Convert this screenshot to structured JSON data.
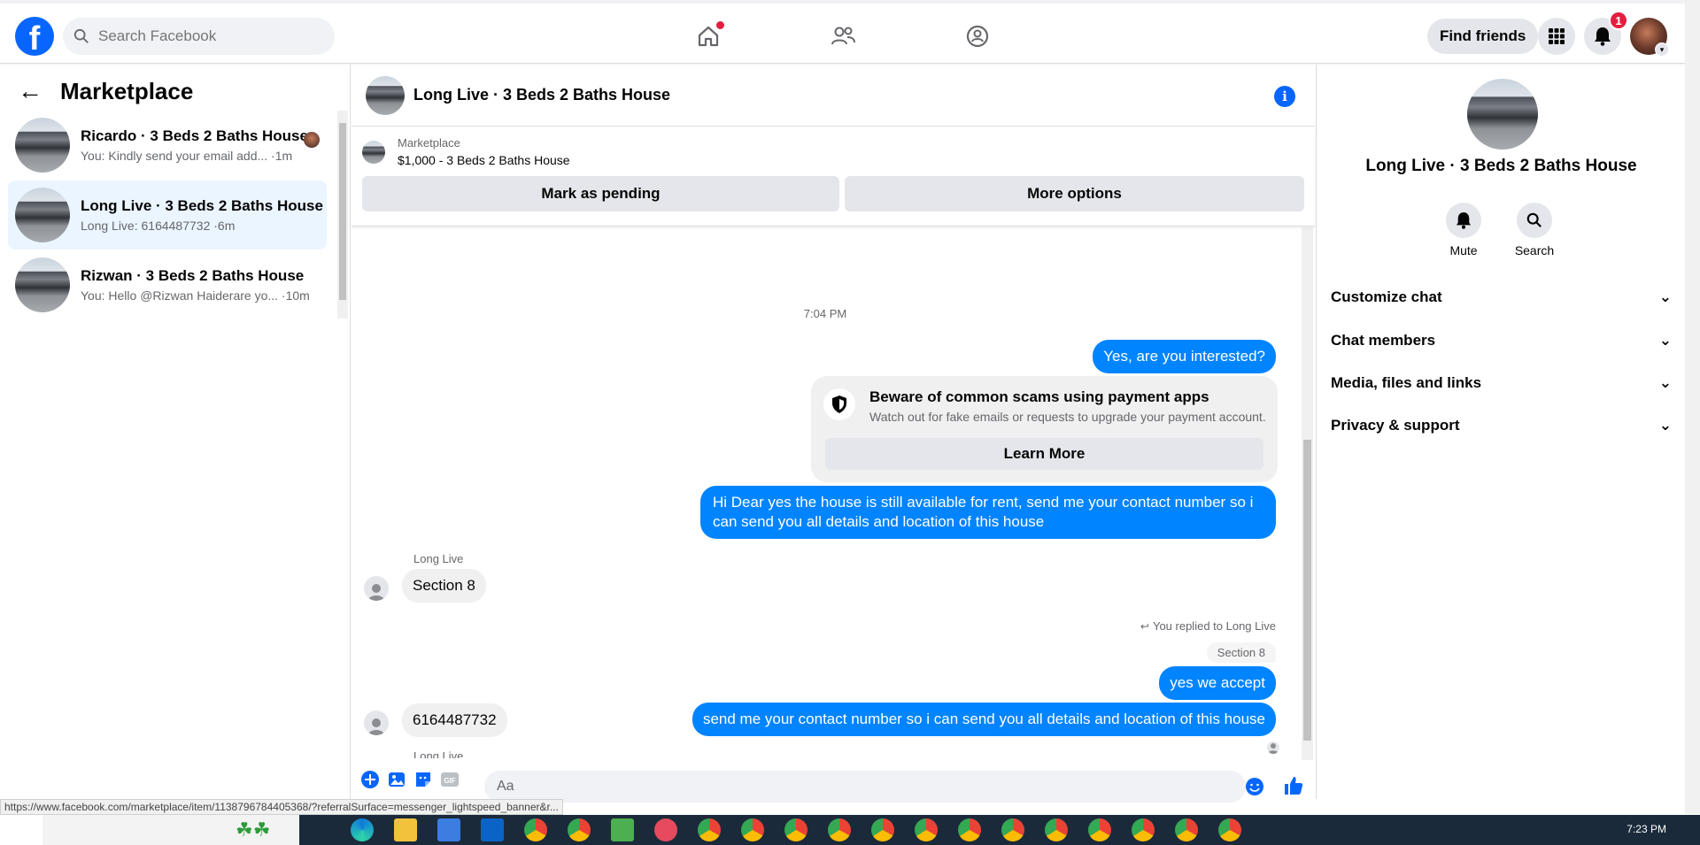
{
  "topbar": {
    "search_placeholder": "Search Facebook",
    "find_friends": "Find friends",
    "notification_count": "1"
  },
  "sidebar": {
    "title": "Marketplace",
    "conversations": [
      {
        "title": "Ricardo · 3 Beds 2 Baths House",
        "preview": "You: Kindly send your email add... ·1m"
      },
      {
        "title": "Long Live · 3 Beds 2 Baths House",
        "preview": "Long Live: 6164487732 ·6m"
      },
      {
        "title": "Rizwan · 3 Beds 2 Baths House",
        "preview": "You: Hello @Rizwan Haiderare yo... ·10m"
      }
    ]
  },
  "chat": {
    "title": "Long Live · 3 Beds 2 Baths House",
    "marketplace_label": "Marketplace",
    "listing": "$1,000 - 3 Beds 2 Baths House",
    "mark_pending": "Mark as pending",
    "more_options": "More options",
    "timestamp": "7:04 PM",
    "messages": {
      "m1": "Yes, are you interested?",
      "m2": "Hi Dear yes the house is still available for rent, send me your contact number so i can send you all details and location of this house",
      "sender_name": "Long Live",
      "m3": "Section 8",
      "replied_label": "You replied to Long Live",
      "quoted": "Section 8",
      "m4": "yes we accept",
      "m5": "send me your contact number so i can send you all details and location of this house",
      "m6": "6164487732"
    },
    "scam_card": {
      "title": "Beware of common scams using payment apps",
      "description": "Watch out for fake emails or requests to upgrade your payment account.",
      "button": "Learn More"
    },
    "composer_placeholder": "Aa"
  },
  "right_panel": {
    "title": "Long Live · 3 Beds 2 Baths House",
    "mute": "Mute",
    "search": "Search",
    "sections": [
      "Customize chat",
      "Chat members",
      "Media, files and links",
      "Privacy & support"
    ]
  },
  "status_url": "https://www.facebook.com/marketplace/item/1138796784405368/?referralSurface=messenger_lightspeed_banner&r...",
  "taskbar": {
    "clock": "7:23 PM"
  },
  "colors": {
    "brand": "#0866ff",
    "outgoing_bubble": "#0084ff",
    "active_conv": "#ebf5ff"
  }
}
